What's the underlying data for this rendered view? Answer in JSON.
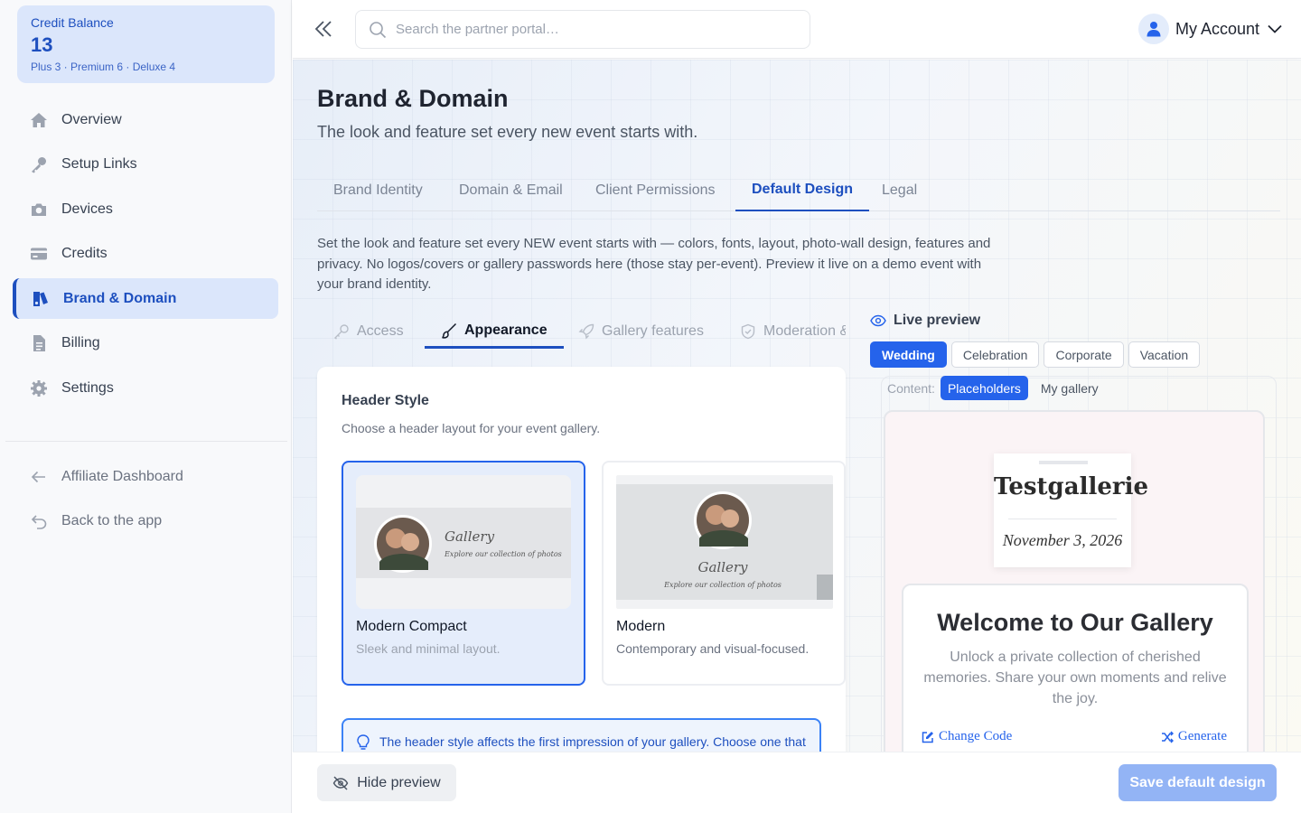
{
  "credit": {
    "title": "Credit Balance",
    "value": "13",
    "breakdown": "Plus 3 · Premium 6 · Deluxe 4"
  },
  "sidebar": {
    "items": [
      {
        "label": "Overview",
        "icon": "home-icon"
      },
      {
        "label": "Setup Links",
        "icon": "key-icon"
      },
      {
        "label": "Devices",
        "icon": "camera-icon"
      },
      {
        "label": "Credits",
        "icon": "credit-card-icon"
      },
      {
        "label": "Brand & Domain",
        "icon": "brand-icon",
        "active": true
      },
      {
        "label": "Billing",
        "icon": "document-icon"
      },
      {
        "label": "Settings",
        "icon": "gear-icon"
      }
    ],
    "secondary": [
      {
        "label": "Affiliate Dashboard",
        "icon": "arrow-left-icon"
      },
      {
        "label": "Back to the app",
        "icon": "undo-icon"
      }
    ]
  },
  "topbar": {
    "search_placeholder": "Search the partner portal…",
    "account_label": "My Account"
  },
  "page": {
    "title": "Brand & Domain",
    "subtitle": "The look and feature set every new event starts with.",
    "tabs": [
      "Brand Identity",
      "Domain & Email",
      "Client Permissions",
      "Default Design",
      "Legal"
    ],
    "active_tab": "Default Design",
    "description": "Set the look and feature set every NEW event starts with — colors, fonts, layout, photo-wall design, features and privacy. No logos/covers or gallery passwords here (those stay per-event). Preview it live on a demo event with your brand identity."
  },
  "subtabs": [
    "Access",
    "Appearance",
    "Gallery features",
    "Moderation & privacy"
  ],
  "active_subtab": "Appearance",
  "header_style": {
    "title": "Header Style",
    "subtitle": "Choose a header layout for your event gallery.",
    "options": [
      {
        "name": "Modern Compact",
        "desc": "Sleek and minimal layout.",
        "thumb_title": "Gallery",
        "thumb_sub": "Explore our collection of photos",
        "selected": true
      },
      {
        "name": "Modern",
        "desc": "Contemporary and visual-focused.",
        "thumb_title": "Gallery",
        "thumb_sub": "Explore our collection of photos",
        "selected": false
      }
    ],
    "tip": "The header style affects the first impression of your gallery. Choose one that"
  },
  "preview": {
    "title": "Live preview",
    "presets": [
      "Wedding",
      "Celebration",
      "Corporate",
      "Vacation"
    ],
    "active_preset": "Wedding",
    "content_label": "Content:",
    "content_options": [
      "Placeholders",
      "My gallery"
    ],
    "active_content": "Placeholders",
    "gallery_name": "Testgallerie",
    "gallery_date": "November 3, 2026",
    "welcome_title": "Welcome to Our Gallery",
    "welcome_text": "Unlock a private collection of cherished memories. Share your own moments and relive the joy.",
    "change_code": "Change Code",
    "generate": "Generate"
  },
  "bottom": {
    "hide_preview": "Hide preview",
    "save": "Save default design"
  },
  "colors": {
    "accent": "#2563eb",
    "accent_dark": "#1d4fbf",
    "save_disabled": "#93b4f5"
  }
}
